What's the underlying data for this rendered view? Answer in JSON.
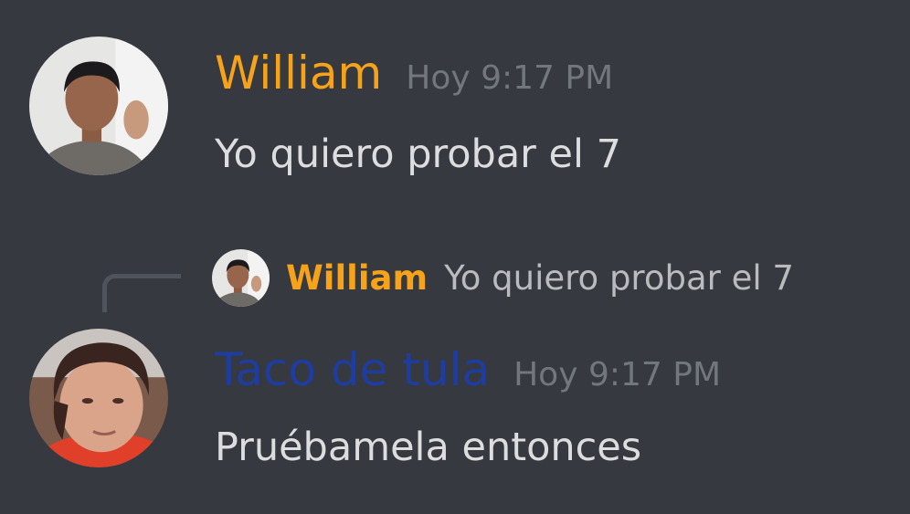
{
  "colors": {
    "background": "#36393f",
    "william_name": "#f6a31a",
    "taco_name": "#1f3d9e",
    "timestamp": "#72767d",
    "message_text": "#dcddde",
    "reply_text": "#b9bbbe"
  },
  "messages": [
    {
      "author": "William",
      "timestamp": "Hoy 9:17 PM",
      "text": "Yo quiero probar el 7"
    },
    {
      "author": "Taco de tula",
      "timestamp": "Hoy 9:17 PM",
      "text": "Pruébamela entonces",
      "reply": {
        "author": "William",
        "text": "Yo quiero probar el 7"
      }
    }
  ]
}
